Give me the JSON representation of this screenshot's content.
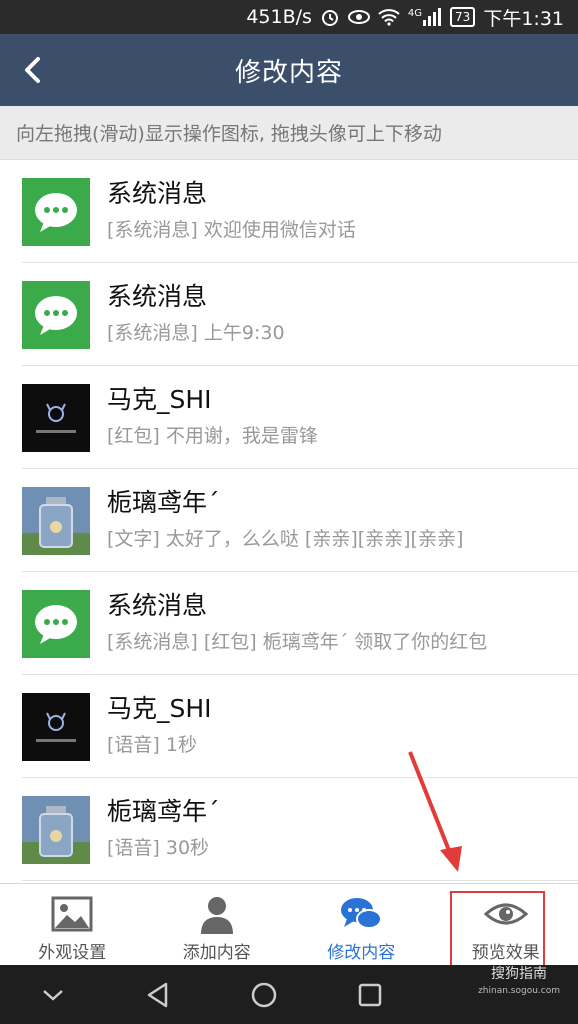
{
  "status": {
    "speed": "451B/s",
    "signal_label": "4G",
    "battery": "73",
    "time": "下午1:31",
    "icons": [
      "alarm-icon",
      "eye-comfort-icon",
      "wifi-icon",
      "signal-icon",
      "battery-icon"
    ]
  },
  "header": {
    "title": "修改内容",
    "back_icon": "chevron-left-icon"
  },
  "hint": "向左拖拽(滑动)显示操作图标, 拖拽头像可上下移动",
  "messages": [
    {
      "name": "系统消息",
      "preview": "[系统消息] 欢迎使用微信对话",
      "avatar": "wechat-chat-icon"
    },
    {
      "name": "系统消息",
      "preview": "[系统消息] 上午9:30",
      "avatar": "wechat-chat-icon"
    },
    {
      "name": "马克_SHI",
      "preview": "[红包] 不用谢，我是雷锋",
      "avatar": "dark-avatar"
    },
    {
      "name": "栀璃鸢年ˊ",
      "preview": "[文字] 太好了，么么哒 [亲亲][亲亲][亲亲]",
      "avatar": "bottle-photo-avatar"
    },
    {
      "name": "系统消息",
      "preview": "[系统消息] [红包] 栀璃鸢年ˊ 领取了你的红包",
      "avatar": "wechat-chat-icon"
    },
    {
      "name": "马克_SHI",
      "preview": "[语音] 1秒",
      "avatar": "dark-avatar"
    },
    {
      "name": "栀璃鸢年ˊ",
      "preview": "[语音] 30秒",
      "avatar": "bottle-photo-avatar"
    }
  ],
  "tabs": [
    {
      "label": "外观设置",
      "icon": "image-icon"
    },
    {
      "label": "添加内容",
      "icon": "person-icon"
    },
    {
      "label": "修改内容",
      "icon": "chat-bubbles-icon",
      "active": true
    },
    {
      "label": "预览效果",
      "icon": "eye-icon"
    }
  ],
  "watermark": {
    "main": "搜狗指南",
    "sub": "zhinan.sogou.com"
  },
  "colors": {
    "header": "#3b4f6b",
    "wechat_green": "#3aaa4a",
    "active_tab": "#2a73d6",
    "highlight": "#e23b3b"
  }
}
